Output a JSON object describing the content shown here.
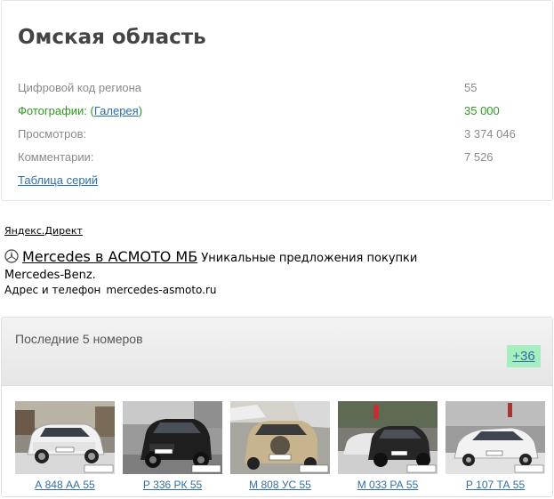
{
  "region": {
    "title": "Омская область",
    "stats": [
      {
        "label": "Цифровой код региона",
        "value": "55"
      },
      {
        "label_prefix": "Фотографии: (",
        "link": "Галерея",
        "label_suffix": ")",
        "value": "35 000"
      },
      {
        "label": "Просмотров:",
        "value": "3 374 046"
      },
      {
        "label": "Комментарии:",
        "value": "7 526"
      }
    ],
    "series_link": "Таблица серий"
  },
  "ad": {
    "source": "Яндекс.Директ",
    "title": "Mercedes в АСМОТО МБ",
    "text": "Уникальные предложения покупки Mercedes-Benz.",
    "contacts_label": "Адрес и телефон",
    "site": "mercedes-asmoto.ru",
    "icon": "mercedes-star-icon"
  },
  "latest": {
    "title": "Последние 5 номеров",
    "more": "+36",
    "plates": [
      {
        "number": "А 848 АА 55"
      },
      {
        "number": "Р 336 РК 55"
      },
      {
        "number": "М 808 УС 55"
      },
      {
        "number": "М 033 РА 55"
      },
      {
        "number": "Р 107 ТА 55"
      }
    ]
  },
  "colors": {
    "accent_green": "#2e9a1f",
    "link": "#2f6fa8",
    "badge_bg": "#a6eec0"
  }
}
